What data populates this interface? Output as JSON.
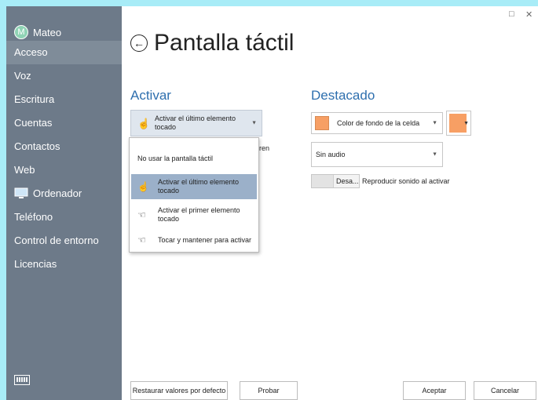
{
  "window": {
    "minimize_glyph": "□",
    "close_glyph": "✕"
  },
  "sidebar": {
    "user": {
      "initial": "M",
      "name": "Mateo"
    },
    "items": [
      {
        "label": "Acceso",
        "active": true
      },
      {
        "label": "Voz"
      },
      {
        "label": "Escritura"
      },
      {
        "label": "Cuentas"
      },
      {
        "label": "Contactos"
      },
      {
        "label": "Web"
      },
      {
        "label": "Ordenador",
        "icon": "monitor-icon"
      },
      {
        "label": "Teléfono"
      },
      {
        "label": "Control de entorno"
      },
      {
        "label": "Licencias"
      }
    ],
    "bottom_icon": "keyboard-icon"
  },
  "page": {
    "title": "Pantalla táctil",
    "back_icon": "back-arrow-icon"
  },
  "activate": {
    "heading": "Activar",
    "selected_value": "Activar el último elemento tocado",
    "partially_hidden_text": "duren",
    "options": [
      {
        "label": "No usar la pantalla táctil",
        "icon": ""
      },
      {
        "label": "Activar el último elemento tocado",
        "icon": "hand-tap-icon",
        "selected": true
      },
      {
        "label": "Activar el primer elemento tocado",
        "icon": "hand-point-icon"
      },
      {
        "label": "Tocar y mantener para activar",
        "icon": "hand-hold-icon"
      }
    ]
  },
  "highlight": {
    "heading": "Destacado",
    "style_value": "Color de fondo de la celda",
    "color": "#f79f64",
    "audio_value": "Sin audio",
    "toggle_state": "Desa...",
    "toggle_label": "Reproducir sonido al activar"
  },
  "footer": {
    "restore": "Restaurar valores por defecto",
    "test": "Probar",
    "accept": "Aceptar",
    "cancel": "Cancelar"
  },
  "colors": {
    "sidebar_bg": "#6d7a89",
    "accent_heading": "#2e6fae",
    "selected_option_bg": "#9bb0c9",
    "outer_bg": "#a8ecf7"
  }
}
